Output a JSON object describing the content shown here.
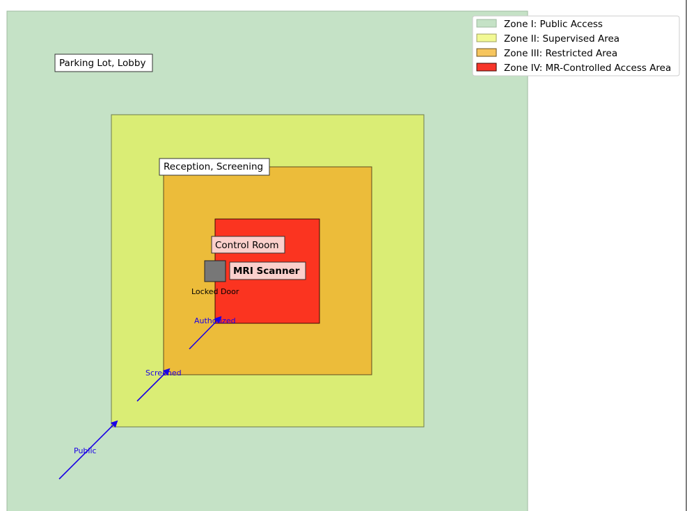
{
  "zones": [
    {
      "id": "zone1",
      "legend": "Zone I: Public Access",
      "fill": "#c5e2c6",
      "label": "Parking Lot, Lobby"
    },
    {
      "id": "zone2",
      "legend": "Zone II: Supervised Area",
      "fill": "#daed75",
      "label": ""
    },
    {
      "id": "zone3",
      "legend": "Zone III: Restricted Area",
      "fill": "#ecbc3a",
      "label": "Reception, Screening"
    },
    {
      "id": "zone4",
      "legend": "Zone IV: MR-Controlled Access Area",
      "fill": "#fb3420",
      "label": "Control Room"
    }
  ],
  "legend_swatches": [
    "#c5e2c6",
    "#f2f994",
    "#f6c55e",
    "#f7352a"
  ],
  "scanner": {
    "label": "MRI Scanner",
    "label_bg": "#fbd0cc"
  },
  "door": {
    "label": "Locked Door",
    "fill": "#777777"
  },
  "arrows": [
    {
      "label": "Public"
    },
    {
      "label": "Screened"
    },
    {
      "label": "Authorized"
    }
  ],
  "arrow_color": "#1a00e6"
}
